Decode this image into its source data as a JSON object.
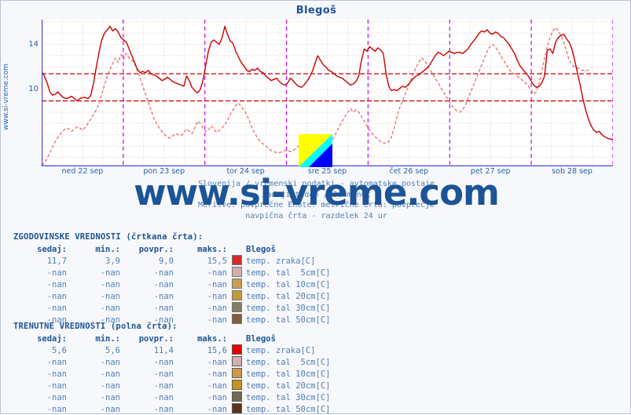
{
  "chart_title": "Blegoš",
  "side_watermark": "www.si-vreme.com",
  "big_watermark": "www.si-vreme.com",
  "subtitle": {
    "line1": "Slovenija / vremenski podatki - avtomatske postaje",
    "line2": "zadnji teden / 30 minut",
    "line3": "Meritve: povprečne  Enote: metrične  Črta: povprečje",
    "line4": "navpična črta - razdelek 24 ur"
  },
  "colors": {
    "accent_blue": "#1c5496",
    "label_blue": "#4f7fb5",
    "axis_blue": "#4a46d8",
    "series_red": "#cc0000",
    "series_red_light": "#e87777",
    "day_divider": "#cc00ff",
    "grid": "#f0c8c8",
    "page_bg": "#f7f8fc",
    "plot_bg": "#ffffff",
    "logo_yellow": "#ffff00",
    "logo_cyan": "#00ffff",
    "logo_blue": "#0000ff"
  },
  "chart_data": {
    "type": "line",
    "title": "Blegoš",
    "xlabel": "",
    "ylabel": "",
    "ylim": [
      3.2,
      16.2
    ],
    "yticks": [
      10,
      14
    ],
    "grid": true,
    "legend_position": "below-table",
    "xlabel_ticks": [
      "ned 22 sep",
      "pon 23 sep",
      "tor 24 sep",
      "sre 25 sep",
      "čet 26 sep",
      "pet 27 sep",
      "sob 28 sep"
    ],
    "day_divider_note": "navpična črta - razdelek 24 ur",
    "avg_lines": [
      11.4,
      9.0
    ],
    "series": [
      {
        "name": "temp. zraka[C] (trenutne / polna črta)",
        "style": "solid",
        "color": "#cc0000",
        "values": [
          11.6,
          11.2,
          10.6,
          9.8,
          9.5,
          9.6,
          9.8,
          9.5,
          9.3,
          9.2,
          9.3,
          9.4,
          9.2,
          9.0,
          9.2,
          9.3,
          9.3,
          9.2,
          9.5,
          10.6,
          12.0,
          13.3,
          14.4,
          15.0,
          15.3,
          15.6,
          15.2,
          15.4,
          15.1,
          14.6,
          14.4,
          14.2,
          13.6,
          13.0,
          12.4,
          11.8,
          11.5,
          11.6,
          11.5,
          11.7,
          11.4,
          11.3,
          11.2,
          11.0,
          10.8,
          10.9,
          11.1,
          10.9,
          10.7,
          10.6,
          10.5,
          10.4,
          10.3,
          11.2,
          10.8,
          10.2,
          9.9,
          9.7,
          10.0,
          10.8,
          12.1,
          13.4,
          14.2,
          14.4,
          14.2,
          14.0,
          14.6,
          15.6,
          14.9,
          14.3,
          14.1,
          13.4,
          12.9,
          12.4,
          12.1,
          11.7,
          11.6,
          11.8,
          11.7,
          11.9,
          11.6,
          11.5,
          11.2,
          11.0,
          10.8,
          10.9,
          11.0,
          10.7,
          10.5,
          10.4,
          10.6,
          11.0,
          10.8,
          10.5,
          10.3,
          10.2,
          10.4,
          10.7,
          11.1,
          11.6,
          12.3,
          13.0,
          12.6,
          12.2,
          12.0,
          11.7,
          11.6,
          11.4,
          11.2,
          11.1,
          11.0,
          10.8,
          10.6,
          10.4,
          10.5,
          10.7,
          11.2,
          12.6,
          13.6,
          13.4,
          13.8,
          13.6,
          13.4,
          13.7,
          13.5,
          13.2,
          11.4,
          10.3,
          9.9,
          10.0,
          9.9,
          10.1,
          10.3,
          10.2,
          10.4,
          10.7,
          11.0,
          11.2,
          11.3,
          11.5,
          11.7,
          11.9,
          12.2,
          12.6,
          13.0,
          13.3,
          13.2,
          13.0,
          13.2,
          13.4,
          13.3,
          13.2,
          13.3,
          13.3,
          13.2,
          13.4,
          13.6,
          14.0,
          14.3,
          14.6,
          15.0,
          15.2,
          15.1,
          15.3,
          15.0,
          14.9,
          15.1,
          15.0,
          14.7,
          14.6,
          14.3,
          14.0,
          13.6,
          13.2,
          12.6,
          12.1,
          11.8,
          11.5,
          11.2,
          10.8,
          10.4,
          10.2,
          10.3,
          10.6,
          11.2,
          13.5,
          13.6,
          13.2,
          14.2,
          14.6,
          14.8,
          14.9,
          14.5,
          14.2,
          13.6,
          12.6,
          11.5,
          10.4,
          9.2,
          8.2,
          7.4,
          6.8,
          6.4,
          6.2,
          6.3,
          6.0,
          5.8,
          5.7,
          5.6,
          5.6
        ],
        "summary": {
          "sedaj": "5,6",
          "min": "5,6",
          "povpr": "11,4",
          "maks": "15,6"
        }
      },
      {
        "name": "temp. zraka[C] (zgodovinske / črtkana črta)",
        "style": "dashed",
        "color": "#e87777",
        "values": [
          3.3,
          3.5,
          3.9,
          4.4,
          4.9,
          5.4,
          5.8,
          6.1,
          6.4,
          6.6,
          6.5,
          6.3,
          6.5,
          6.7,
          6.6,
          6.4,
          6.7,
          7.0,
          7.4,
          7.8,
          8.2,
          8.8,
          9.6,
          10.4,
          11.2,
          11.8,
          12.3,
          12.8,
          12.4,
          13.1,
          12.7,
          13.2,
          12.8,
          12.6,
          12.3,
          11.7,
          11.0,
          10.3,
          9.6,
          8.9,
          8.2,
          7.5,
          7.0,
          6.6,
          6.3,
          6.0,
          5.8,
          5.7,
          5.9,
          6.1,
          6.0,
          5.9,
          6.2,
          6.5,
          6.3,
          6.1,
          6.6,
          7.2,
          7.0,
          6.6,
          6.3,
          6.4,
          6.8,
          6.5,
          6.2,
          6.4,
          6.6,
          6.9,
          7.3,
          7.8,
          8.2,
          8.6,
          8.8,
          8.5,
          8.2,
          7.8,
          7.2,
          6.6,
          6.1,
          5.7,
          5.4,
          5.2,
          5.0,
          4.8,
          4.6,
          4.5,
          4.4,
          4.4,
          4.5,
          4.6,
          4.6,
          4.5,
          4.6,
          4.8,
          5.0,
          5.1,
          5.0,
          4.9,
          5.0,
          5.1,
          5.2,
          5.1,
          5.0,
          4.9,
          5.0,
          5.2,
          5.4,
          5.8,
          6.3,
          6.8,
          7.2,
          7.6,
          8.0,
          8.3,
          8.0,
          8.2,
          8.0,
          7.6,
          7.2,
          6.8,
          6.4,
          6.1,
          5.8,
          5.6,
          5.4,
          5.3,
          5.2,
          5.4,
          5.8,
          6.6,
          7.6,
          8.4,
          9.0,
          9.6,
          10.2,
          10.8,
          11.4,
          12.0,
          12.4,
          12.8,
          12.6,
          12.2,
          11.8,
          11.4,
          11.0,
          10.6,
          10.2,
          9.8,
          9.4,
          9.0,
          8.6,
          8.3,
          8.1,
          8.0,
          8.2,
          8.6,
          9.2,
          9.8,
          10.4,
          11.0,
          11.6,
          12.2,
          12.8,
          13.4,
          13.8,
          14.0,
          13.8,
          13.4,
          13.0,
          12.6,
          12.2,
          11.8,
          11.5,
          11.4,
          11.2,
          11.0,
          10.8,
          10.6,
          10.3,
          10.0,
          9.6,
          9.8,
          10.6,
          11.6,
          12.8,
          13.8,
          14.6,
          15.2,
          15.5,
          15.2,
          14.8,
          14.2,
          13.4,
          12.6,
          12.2,
          12.0,
          11.9,
          11.8,
          11.7,
          11.7,
          11.7
        ],
        "summary": {
          "sedaj": "11,7",
          "min": "3,9",
          "povpr": "9,0",
          "maks": "15,5"
        }
      }
    ]
  },
  "historic_table": {
    "heading": "ZGODOVINSKE VREDNOSTI (črtkana črta):",
    "columns": [
      "sedaj:",
      "min.:",
      "povpr.:",
      "maks.:",
      "Blegoš"
    ],
    "rows": [
      {
        "sedaj": "11,7",
        "min": "3,9",
        "povpr": "9,0",
        "maks": "15,5",
        "color": "#cc0000",
        "label": "temp. zraka[C]"
      },
      {
        "sedaj": "-nan",
        "min": "-nan",
        "povpr": "-nan",
        "maks": "-nan",
        "color": "#c9a0a0",
        "label": "temp. tal  5cm[C]"
      },
      {
        "sedaj": "-nan",
        "min": "-nan",
        "povpr": "-nan",
        "maks": "-nan",
        "color": "#c08c30",
        "label": "temp. tal 10cm[C]"
      },
      {
        "sedaj": "-nan",
        "min": "-nan",
        "povpr": "-nan",
        "maks": "-nan",
        "color": "#b8860b",
        "label": "temp. tal 20cm[C]"
      },
      {
        "sedaj": "-nan",
        "min": "-nan",
        "povpr": "-nan",
        "maks": "-nan",
        "color": "#6b6344",
        "label": "temp. tal 30cm[C]"
      },
      {
        "sedaj": "-nan",
        "min": "-nan",
        "povpr": "-nan",
        "maks": "-nan",
        "color": "#6b3a10",
        "label": "temp. tal 50cm[C]"
      }
    ]
  },
  "current_table": {
    "heading": "TRENUTNE VREDNOSTI (polna črta):",
    "columns": [
      "sedaj:",
      "min.:",
      "povpr.:",
      "maks.:",
      "Blegoš"
    ],
    "rows": [
      {
        "sedaj": "5,6",
        "min": "5,6",
        "povpr": "11,4",
        "maks": "15,6",
        "color": "#e60000",
        "label": "temp. zraka[C]"
      },
      {
        "sedaj": "-nan",
        "min": "-nan",
        "povpr": "-nan",
        "maks": "-nan",
        "color": "#d4b0b0",
        "label": "temp. tal  5cm[C]"
      },
      {
        "sedaj": "-nan",
        "min": "-nan",
        "povpr": "-nan",
        "maks": "-nan",
        "color": "#cc9944",
        "label": "temp. tal 10cm[C]"
      },
      {
        "sedaj": "-nan",
        "min": "-nan",
        "povpr": "-nan",
        "maks": "-nan",
        "color": "#c8921a",
        "label": "temp. tal 20cm[C]"
      },
      {
        "sedaj": "-nan",
        "min": "-nan",
        "povpr": "-nan",
        "maks": "-nan",
        "color": "#70694b",
        "label": "temp. tal 30cm[C]"
      },
      {
        "sedaj": "-nan",
        "min": "-nan",
        "povpr": "-nan",
        "maks": "-nan",
        "color": "#5e3314",
        "label": "temp. tal 50cm[C]"
      }
    ]
  }
}
